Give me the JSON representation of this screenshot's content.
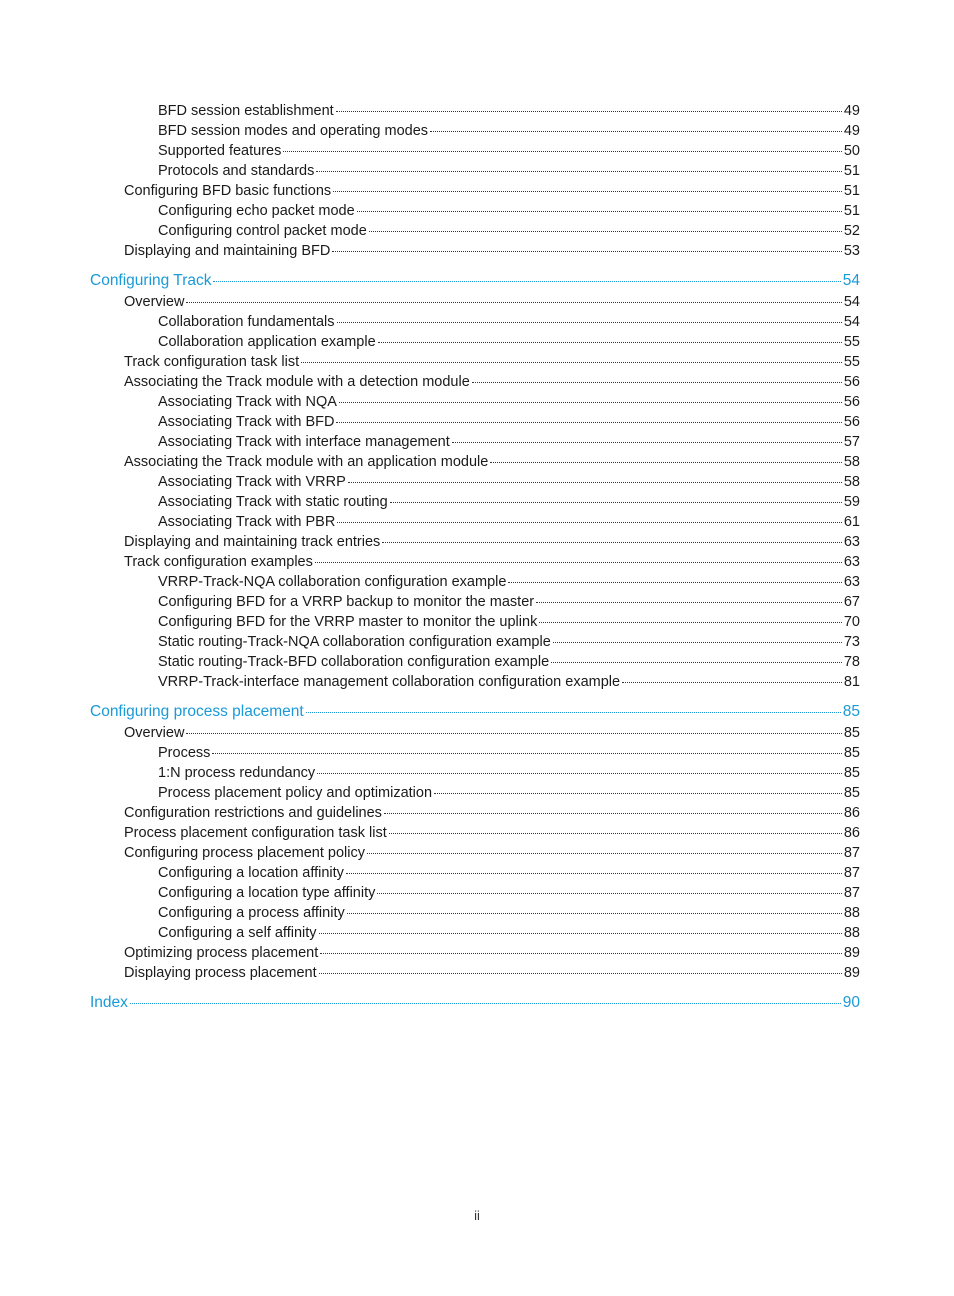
{
  "toc": [
    {
      "level": 2,
      "title": "BFD session establishment",
      "page": "49"
    },
    {
      "level": 2,
      "title": "BFD session modes and operating modes",
      "page": "49"
    },
    {
      "level": 2,
      "title": "Supported features",
      "page": "50"
    },
    {
      "level": 2,
      "title": "Protocols and standards",
      "page": "51"
    },
    {
      "level": 1,
      "title": "Configuring BFD basic functions",
      "page": "51"
    },
    {
      "level": 2,
      "title": "Configuring echo packet mode",
      "page": "51"
    },
    {
      "level": 2,
      "title": "Configuring control packet mode",
      "page": "52"
    },
    {
      "level": 1,
      "title": "Displaying and maintaining BFD",
      "page": "53"
    },
    {
      "level": 0,
      "title": "Configuring Track",
      "page": "54"
    },
    {
      "level": 1,
      "title": "Overview",
      "page": "54"
    },
    {
      "level": 2,
      "title": "Collaboration fundamentals",
      "page": "54"
    },
    {
      "level": 2,
      "title": "Collaboration application example",
      "page": "55"
    },
    {
      "level": 1,
      "title": "Track configuration task list",
      "page": "55"
    },
    {
      "level": 1,
      "title": "Associating the Track module with a detection module",
      "page": "56"
    },
    {
      "level": 2,
      "title": "Associating Track with NQA",
      "page": "56"
    },
    {
      "level": 2,
      "title": "Associating Track with BFD",
      "page": "56"
    },
    {
      "level": 2,
      "title": "Associating Track with interface management",
      "page": "57"
    },
    {
      "level": 1,
      "title": "Associating the Track module with an application module",
      "page": "58"
    },
    {
      "level": 2,
      "title": "Associating Track with VRRP",
      "page": "58"
    },
    {
      "level": 2,
      "title": "Associating Track with static routing",
      "page": "59"
    },
    {
      "level": 2,
      "title": "Associating Track with PBR",
      "page": "61"
    },
    {
      "level": 1,
      "title": "Displaying and maintaining track entries",
      "page": "63"
    },
    {
      "level": 1,
      "title": "Track configuration examples",
      "page": "63"
    },
    {
      "level": 2,
      "title": "VRRP-Track-NQA collaboration configuration example",
      "page": "63"
    },
    {
      "level": 2,
      "title": "Configuring BFD for a VRRP backup to monitor the master",
      "page": "67"
    },
    {
      "level": 2,
      "title": "Configuring BFD for the VRRP master to monitor the uplink",
      "page": "70"
    },
    {
      "level": 2,
      "title": "Static routing-Track-NQA collaboration configuration example",
      "page": "73"
    },
    {
      "level": 2,
      "title": "Static routing-Track-BFD collaboration configuration example",
      "page": "78"
    },
    {
      "level": 2,
      "title": "VRRP-Track-interface management collaboration configuration example",
      "page": "81"
    },
    {
      "level": 0,
      "title": "Configuring process placement",
      "page": "85"
    },
    {
      "level": 1,
      "title": "Overview",
      "page": "85"
    },
    {
      "level": 2,
      "title": "Process",
      "page": "85"
    },
    {
      "level": 2,
      "title": "1:N process redundancy",
      "page": "85"
    },
    {
      "level": 2,
      "title": "Process placement policy and optimization",
      "page": "85"
    },
    {
      "level": 1,
      "title": "Configuration restrictions and guidelines",
      "page": "86"
    },
    {
      "level": 1,
      "title": "Process placement configuration task list",
      "page": "86"
    },
    {
      "level": 1,
      "title": "Configuring process placement policy",
      "page": "87"
    },
    {
      "level": 2,
      "title": "Configuring a location affinity",
      "page": "87"
    },
    {
      "level": 2,
      "title": "Configuring a location type affinity",
      "page": "87"
    },
    {
      "level": 2,
      "title": "Configuring a process affinity",
      "page": "88"
    },
    {
      "level": 2,
      "title": "Configuring a self affinity",
      "page": "88"
    },
    {
      "level": 1,
      "title": "Optimizing process placement",
      "page": "89"
    },
    {
      "level": 1,
      "title": "Displaying process placement",
      "page": "89"
    },
    {
      "level": 0,
      "title": "Index",
      "page": "90"
    }
  ],
  "footer": {
    "page_number": "ii"
  },
  "colors": {
    "chapter_link": "#1a9ad6",
    "text": "#1a1a1a"
  }
}
